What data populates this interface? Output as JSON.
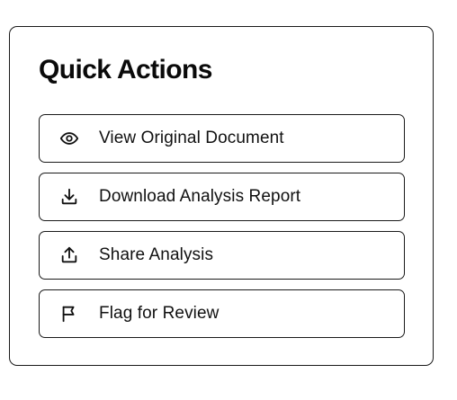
{
  "quick_actions": {
    "title": "Quick Actions",
    "items": [
      {
        "label": "View Original Document",
        "icon": "eye-icon"
      },
      {
        "label": "Download Analysis Report",
        "icon": "download-icon"
      },
      {
        "label": "Share Analysis",
        "icon": "share-icon"
      },
      {
        "label": "Flag for Review",
        "icon": "flag-icon"
      }
    ]
  }
}
